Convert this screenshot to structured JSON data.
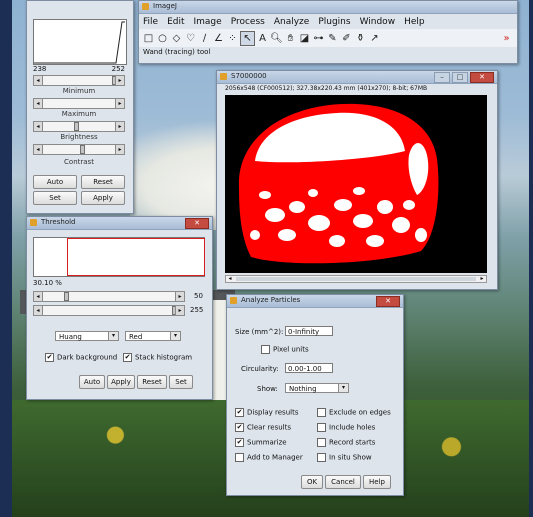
{
  "imagej": {
    "title": "ImageJ",
    "menus": [
      "File",
      "Edit",
      "Image",
      "Process",
      "Analyze",
      "Plugins",
      "Window",
      "Help"
    ],
    "tools": [
      {
        "icon": "rectangle-tool-icon",
        "glyph": "□"
      },
      {
        "icon": "oval-tool-icon",
        "glyph": "○"
      },
      {
        "icon": "polygon-tool-icon",
        "glyph": "◇"
      },
      {
        "icon": "freehand-tool-icon",
        "glyph": "♡"
      },
      {
        "icon": "line-tool-icon",
        "glyph": "∕"
      },
      {
        "icon": "angle-tool-icon",
        "glyph": "∠"
      },
      {
        "icon": "point-tool-icon",
        "glyph": "⁘"
      },
      {
        "icon": "wand-tool-icon",
        "glyph": "↖"
      },
      {
        "icon": "text-tool-icon",
        "glyph": "A"
      },
      {
        "icon": "magnifier-tool-icon",
        "glyph": "🔍︎"
      },
      {
        "icon": "hand-tool-icon",
        "glyph": "✋︎"
      },
      {
        "icon": "dropper-tool-icon",
        "glyph": "◪"
      },
      {
        "icon": "lut-tool-icon",
        "glyph": "⊶"
      },
      {
        "icon": "brush-tool-icon",
        "glyph": "✎"
      },
      {
        "icon": "pencil-tool-icon",
        "glyph": "✐"
      },
      {
        "icon": "flood-fill-tool-icon",
        "glyph": "⚱"
      },
      {
        "icon": "arrow-tool-icon",
        "glyph": "↗"
      },
      {
        "icon": "more-tools-icon",
        "glyph": "»"
      }
    ],
    "status": "Wand (tracing) tool"
  },
  "bc": {
    "min_value": "238",
    "max_value": "252",
    "minimum_label": "Minimum",
    "maximum_label": "Maximum",
    "brightness_label": "Brightness",
    "contrast_label": "Contrast",
    "auto_label": "Auto",
    "reset_label": "Reset",
    "set_label": "Set",
    "apply_label": "Apply"
  },
  "image_window": {
    "title": "S7000000",
    "info": "2056x548 (CF000512); 327.38x220.43 mm (401x270); 8-bit; 67MB"
  },
  "threshold": {
    "title": "Threshold",
    "percent": "30.10 %",
    "min_value": "50",
    "max_value": "255",
    "method": "Huang",
    "mode": "Red",
    "dark_bg_label": "Dark background",
    "stack_hist_label": "Stack histogram",
    "auto_label": "Auto",
    "apply_label": "Apply",
    "reset_label": "Reset",
    "set_label": "Set"
  },
  "analyze": {
    "title": "Analyze Particles",
    "size_label": "Size (mm^2):",
    "size_value": "0-Infinity",
    "pixel_units_label": "Pixel units",
    "circularity_label": "Circularity:",
    "circularity_value": "0.00-1.00",
    "show_label": "Show:",
    "show_value": "Nothing",
    "opt_display": "Display results",
    "opt_clear": "Clear results",
    "opt_summarize": "Summarize",
    "opt_add_manager": "Add to Manager",
    "opt_exclude": "Exclude on edges",
    "opt_include_holes": "Include holes",
    "opt_record": "Record starts",
    "opt_in_situ": "In situ Show",
    "ok_label": "OK",
    "cancel_label": "Cancel",
    "help_label": "Help",
    "checked_mark": "✔"
  }
}
